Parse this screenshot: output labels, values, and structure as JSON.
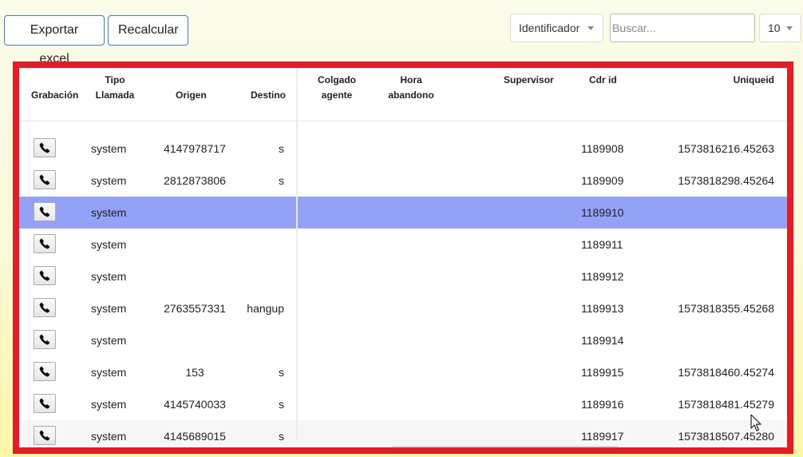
{
  "toolbar": {
    "export_label": "Exportar excel",
    "recalc_label": "Recalcular",
    "filter_field": "Identificador",
    "search_placeholder": "Buscar...",
    "page_size": "10"
  },
  "table": {
    "headers": {
      "grabacion": "Grabación",
      "tipo_l1": "Tipo",
      "tipo_l2": "Llamada",
      "origen": "Origen",
      "destino": "Destino",
      "colgado_l1": "Colgado",
      "colgado_l2": "agente",
      "hora_l1": "Hora",
      "hora_l2": "abandono",
      "supervisor": "Supervisor",
      "cdr": "Cdr id",
      "uniqueid": "Uniqueid"
    },
    "rows": [
      {
        "tipo": "system",
        "origen": "4147978717",
        "destino": "s",
        "cdr": "1189908",
        "uniqueid": "1573816216.45263"
      },
      {
        "tipo": "system",
        "origen": "2812873806",
        "destino": "s",
        "cdr": "1189909",
        "uniqueid": "1573818298.45264"
      },
      {
        "tipo": "system",
        "origen": "",
        "destino": "",
        "cdr": "1189910",
        "uniqueid": ""
      },
      {
        "tipo": "system",
        "origen": "",
        "destino": "",
        "cdr": "1189911",
        "uniqueid": ""
      },
      {
        "tipo": "system",
        "origen": "",
        "destino": "",
        "cdr": "1189912",
        "uniqueid": ""
      },
      {
        "tipo": "system",
        "origen": "2763557331",
        "destino": "hangup",
        "cdr": "1189913",
        "uniqueid": "1573818355.45268"
      },
      {
        "tipo": "system",
        "origen": "",
        "destino": "",
        "cdr": "1189914",
        "uniqueid": ""
      },
      {
        "tipo": "system",
        "origen": "153",
        "destino": "s",
        "cdr": "1189915",
        "uniqueid": "1573818460.45274"
      },
      {
        "tipo": "system",
        "origen": "4145740033",
        "destino": "s",
        "cdr": "1189916",
        "uniqueid": "1573818481.45279"
      },
      {
        "tipo": "system",
        "origen": "4145689015",
        "destino": "s",
        "cdr": "1189917",
        "uniqueid": "1573818507.45280"
      }
    ],
    "selected_row": 2
  },
  "colors": {
    "frame_border": "#e61c24",
    "selected_row": "#93a2f7",
    "button_border": "#3a7ee0"
  },
  "icons": {
    "recording": "phone-icon",
    "dropdown": "caret-down-icon"
  }
}
